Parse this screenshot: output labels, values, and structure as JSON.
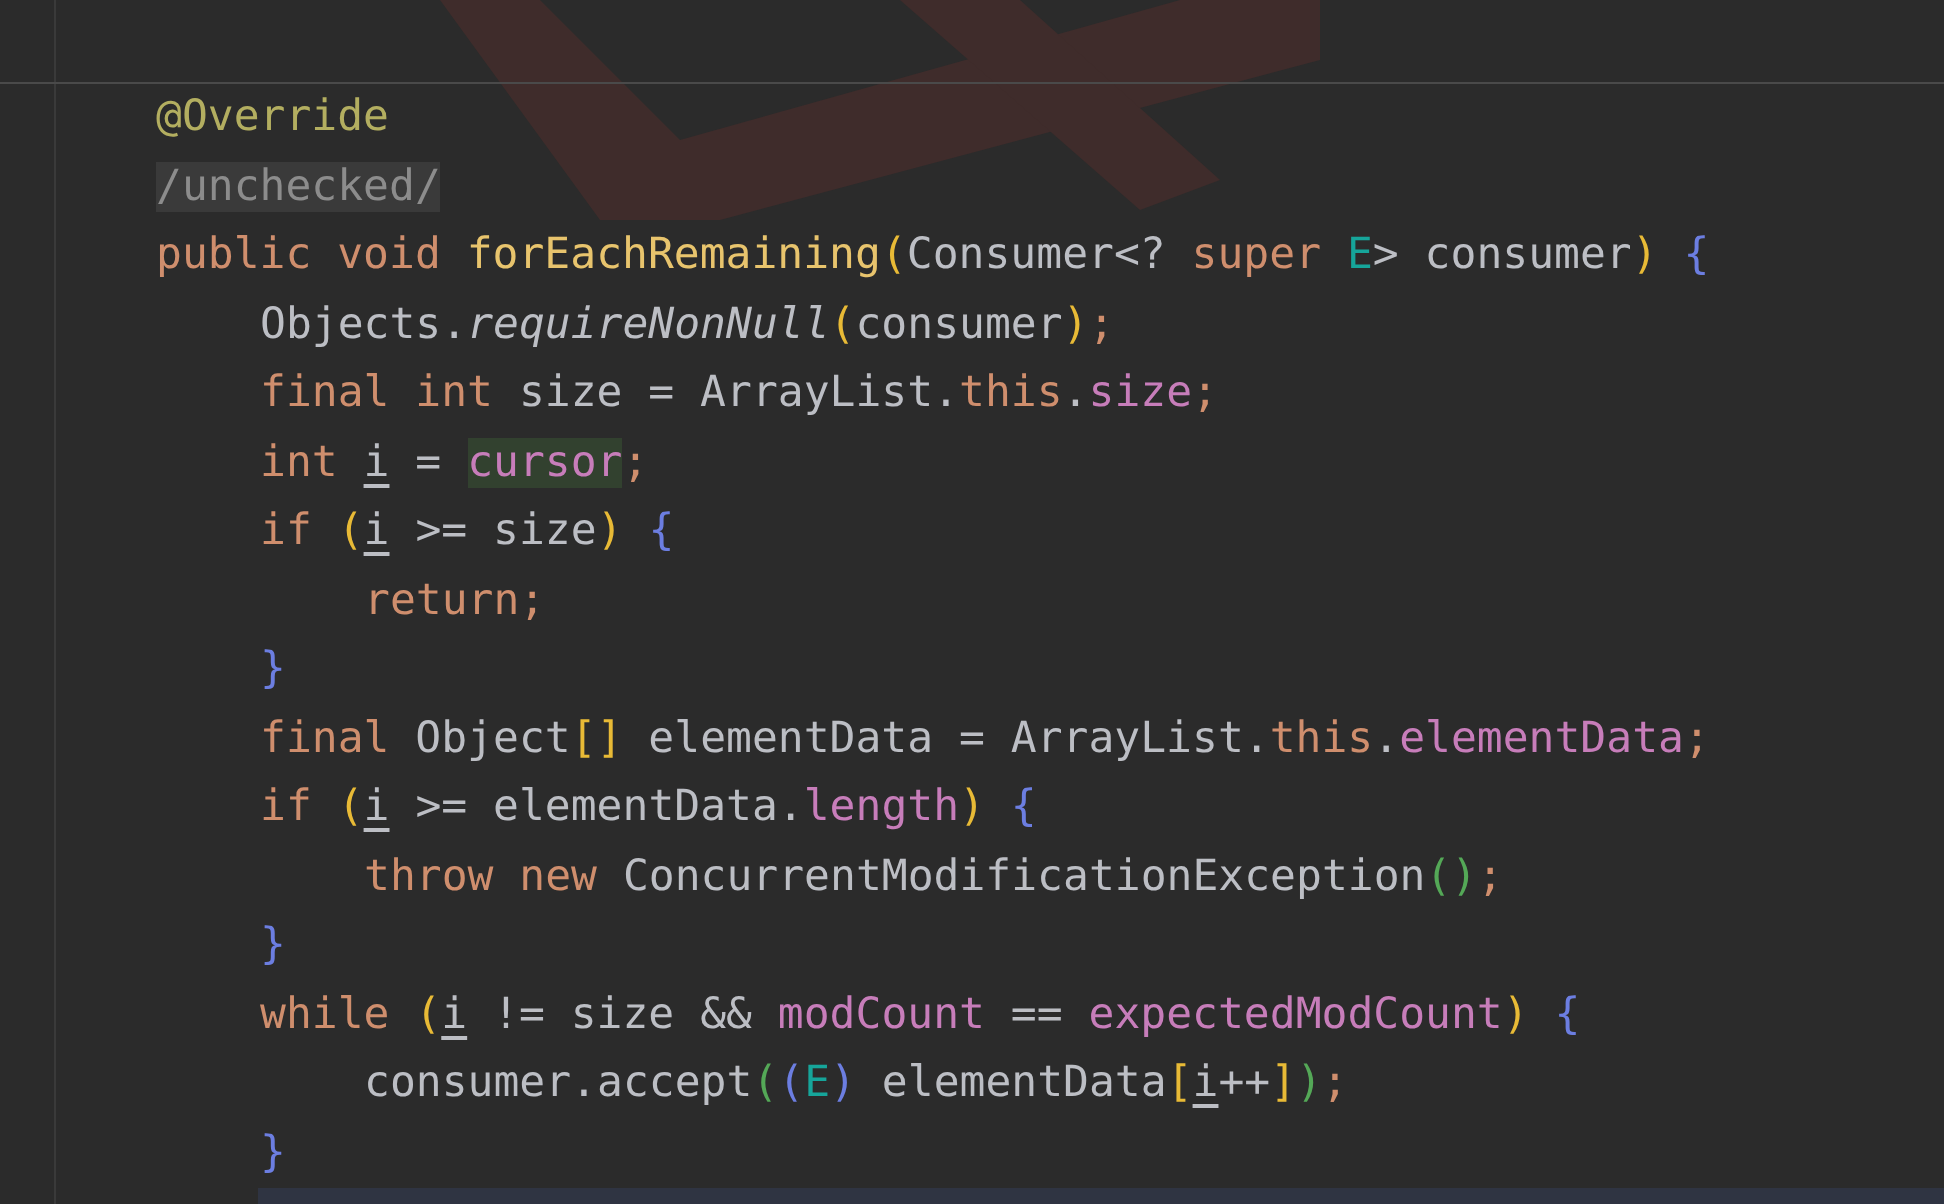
{
  "lines": [
    {
      "tokens": [
        {
          "text": "@Override",
          "kind": "annotation"
        }
      ]
    },
    {
      "tokens": [
        {
          "text": "/unchecked/",
          "kind": "folded"
        }
      ]
    },
    {
      "tokens": [
        {
          "text": "public void ",
          "kind": "keyword"
        },
        {
          "text": "forEachRemaining",
          "kind": "method"
        },
        {
          "text": "(",
          "kind": "paren1"
        },
        {
          "text": "Consumer<? ",
          "kind": "plain"
        },
        {
          "text": "super ",
          "kind": "keyword"
        },
        {
          "text": "E",
          "kind": "type_param"
        },
        {
          "text": "> consumer",
          "kind": "plain"
        },
        {
          "text": ")",
          "kind": "paren1"
        },
        {
          "text": " {",
          "kind": "brace"
        }
      ],
      "children": [
        {
          "tokens": [
            {
              "text": "Objects.",
              "kind": "plain"
            },
            {
              "text": "requireNonNull",
              "kind": "static_call"
            },
            {
              "text": "(",
              "kind": "paren1"
            },
            {
              "text": "consumer",
              "kind": "plain"
            },
            {
              "text": ")",
              "kind": "paren1"
            },
            {
              "text": ";",
              "kind": "keyword"
            }
          ]
        },
        {
          "tokens": [
            {
              "text": "final int ",
              "kind": "keyword"
            },
            {
              "text": "size = ArrayList.",
              "kind": "plain"
            },
            {
              "text": "this",
              "kind": "keyword"
            },
            {
              "text": ".",
              "kind": "plain"
            },
            {
              "text": "size",
              "kind": "field"
            },
            {
              "text": ";",
              "kind": "keyword"
            }
          ]
        },
        {
          "tokens": [
            {
              "text": "int ",
              "kind": "keyword"
            },
            {
              "text": "i",
              "kind": "var"
            },
            {
              "text": " = ",
              "kind": "plain"
            },
            {
              "text": "cursor",
              "kind": "field_marked"
            },
            {
              "text": ";",
              "kind": "keyword"
            }
          ]
        },
        {
          "tokens": [
            {
              "text": "if ",
              "kind": "keyword"
            },
            {
              "text": "(",
              "kind": "paren1"
            },
            {
              "text": "i",
              "kind": "var"
            },
            {
              "text": " >= size",
              "kind": "plain"
            },
            {
              "text": ")",
              "kind": "paren1"
            },
            {
              "text": " {",
              "kind": "brace"
            }
          ],
          "children": [
            {
              "tokens": [
                {
                  "text": "return;",
                  "kind": "keyword"
                }
              ]
            }
          ]
        },
        {
          "tokens": [
            {
              "text": "}",
              "kind": "brace"
            }
          ]
        },
        {
          "tokens": [
            {
              "text": "final ",
              "kind": "keyword"
            },
            {
              "text": "Object",
              "kind": "plain"
            },
            {
              "text": "[]",
              "kind": "paren1"
            },
            {
              "text": " elementData = ArrayList.",
              "kind": "plain"
            },
            {
              "text": "this",
              "kind": "keyword"
            },
            {
              "text": ".",
              "kind": "plain"
            },
            {
              "text": "elementData",
              "kind": "field"
            },
            {
              "text": ";",
              "kind": "keyword"
            }
          ]
        },
        {
          "tokens": [
            {
              "text": "if ",
              "kind": "keyword"
            },
            {
              "text": "(",
              "kind": "paren1"
            },
            {
              "text": "i",
              "kind": "var"
            },
            {
              "text": " >= elementData.",
              "kind": "plain"
            },
            {
              "text": "length",
              "kind": "field"
            },
            {
              "text": ")",
              "kind": "paren1"
            },
            {
              "text": " {",
              "kind": "brace"
            }
          ],
          "children": [
            {
              "tokens": [
                {
                  "text": "throw new ",
                  "kind": "keyword"
                },
                {
                  "text": "ConcurrentModificationException",
                  "kind": "plain"
                },
                {
                  "text": "()",
                  "kind": "paren2"
                },
                {
                  "text": ";",
                  "kind": "keyword"
                }
              ]
            }
          ]
        },
        {
          "tokens": [
            {
              "text": "}",
              "kind": "brace"
            }
          ]
        },
        {
          "tokens": [
            {
              "text": "while ",
              "kind": "keyword"
            },
            {
              "text": "(",
              "kind": "paren1"
            },
            {
              "text": "i",
              "kind": "var"
            },
            {
              "text": " != size && ",
              "kind": "plain"
            },
            {
              "text": "modCount",
              "kind": "field"
            },
            {
              "text": " == ",
              "kind": "plain"
            },
            {
              "text": "expectedModCount",
              "kind": "field"
            },
            {
              "text": ")",
              "kind": "paren1"
            },
            {
              "text": " {",
              "kind": "brace"
            }
          ],
          "children": [
            {
              "tokens": [
                {
                  "text": "consumer.accept",
                  "kind": "plain"
                },
                {
                  "text": "(",
                  "kind": "paren2"
                },
                {
                  "text": "(",
                  "kind": "brace"
                },
                {
                  "text": "E",
                  "kind": "type_param"
                },
                {
                  "text": ")",
                  "kind": "brace"
                },
                {
                  "text": " elementData",
                  "kind": "plain"
                },
                {
                  "text": "[",
                  "kind": "paren1"
                },
                {
                  "text": "i",
                  "kind": "var"
                },
                {
                  "text": "++",
                  "kind": "plain"
                },
                {
                  "text": "]",
                  "kind": "paren1"
                },
                {
                  "text": ")",
                  "kind": "paren2"
                },
                {
                  "text": ";",
                  "kind": "keyword"
                }
              ]
            }
          ]
        },
        {
          "tokens": [
            {
              "text": "}",
              "kind": "brace"
            }
          ]
        }
      ]
    }
  ]
}
